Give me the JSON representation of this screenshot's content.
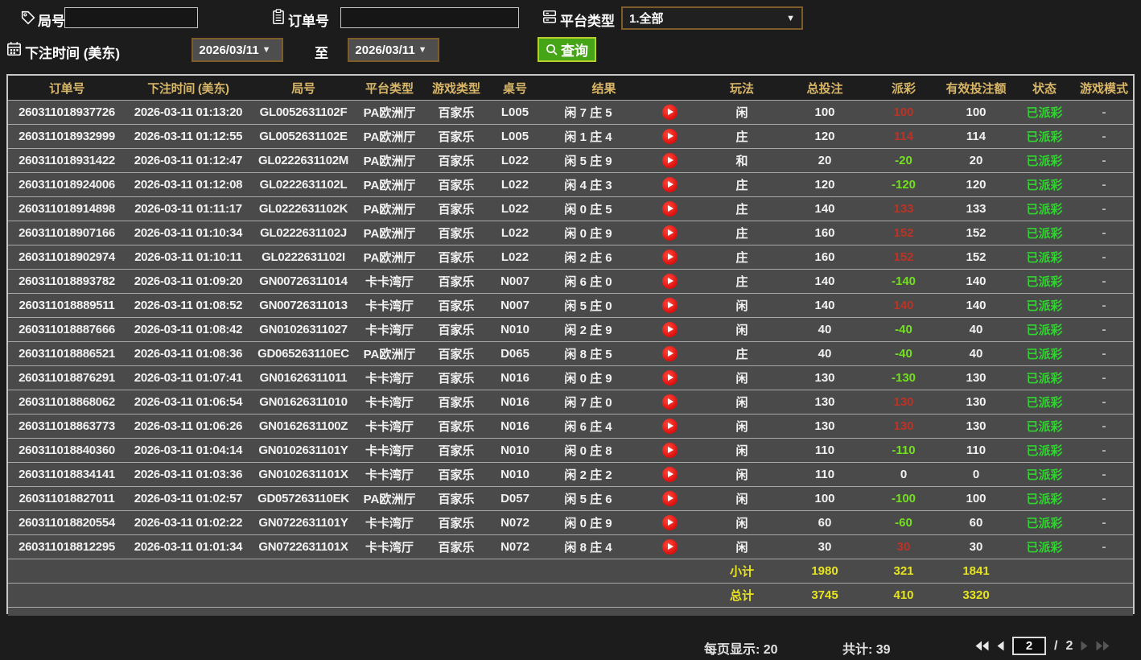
{
  "filters": {
    "round_label": "局号",
    "order_label": "订单号",
    "platform_label": "平台类型",
    "platform_value": "1.全部",
    "bet_time_label": "下注时间 (美东)",
    "date_from": "2026/03/11",
    "to_label": "至",
    "date_to": "2026/03/11",
    "search_label": "查询",
    "dropdown_caret": "▼"
  },
  "table": {
    "headers": [
      "订单号",
      "下注时间 (美东)",
      "局号",
      "平台类型",
      "游戏类型",
      "桌号",
      "结果",
      "玩法",
      "总投注",
      "派彩",
      "有效投注额",
      "状态",
      "游戏模式"
    ],
    "rows": [
      {
        "order": "260311018937726",
        "time": "2026-03-11 01:13:20",
        "round": "GL0052631102F",
        "platform": "PA欧洲厅",
        "game": "百家乐",
        "table": "L005",
        "result": "闲 7 庄 5",
        "play": "闲",
        "bet": "100",
        "payout": "100",
        "payout_color": "pos",
        "valid": "100",
        "status": "已派彩",
        "mode": "-"
      },
      {
        "order": "260311018932999",
        "time": "2026-03-11 01:12:55",
        "round": "GL0052631102E",
        "platform": "PA欧洲厅",
        "game": "百家乐",
        "table": "L005",
        "result": "闲 1 庄 4",
        "play": "庄",
        "bet": "120",
        "payout": "114",
        "payout_color": "pos",
        "valid": "114",
        "status": "已派彩",
        "mode": "-"
      },
      {
        "order": "260311018931422",
        "time": "2026-03-11 01:12:47",
        "round": "GL0222631102M",
        "platform": "PA欧洲厅",
        "game": "百家乐",
        "table": "L022",
        "result": "闲 5 庄 9",
        "play": "和",
        "bet": "20",
        "payout": "-20",
        "payout_color": "neg",
        "valid": "20",
        "status": "已派彩",
        "mode": "-"
      },
      {
        "order": "260311018924006",
        "time": "2026-03-11 01:12:08",
        "round": "GL0222631102L",
        "platform": "PA欧洲厅",
        "game": "百家乐",
        "table": "L022",
        "result": "闲 4 庄 3",
        "play": "庄",
        "bet": "120",
        "payout": "-120",
        "payout_color": "neg",
        "valid": "120",
        "status": "已派彩",
        "mode": "-"
      },
      {
        "order": "260311018914898",
        "time": "2026-03-11 01:11:17",
        "round": "GL0222631102K",
        "platform": "PA欧洲厅",
        "game": "百家乐",
        "table": "L022",
        "result": "闲 0 庄 5",
        "play": "庄",
        "bet": "140",
        "payout": "133",
        "payout_color": "pos",
        "valid": "133",
        "status": "已派彩",
        "mode": "-"
      },
      {
        "order": "260311018907166",
        "time": "2026-03-11 01:10:34",
        "round": "GL0222631102J",
        "platform": "PA欧洲厅",
        "game": "百家乐",
        "table": "L022",
        "result": "闲 0 庄 9",
        "play": "庄",
        "bet": "160",
        "payout": "152",
        "payout_color": "pos",
        "valid": "152",
        "status": "已派彩",
        "mode": "-"
      },
      {
        "order": "260311018902974",
        "time": "2026-03-11 01:10:11",
        "round": "GL0222631102I",
        "platform": "PA欧洲厅",
        "game": "百家乐",
        "table": "L022",
        "result": "闲 2 庄 6",
        "play": "庄",
        "bet": "160",
        "payout": "152",
        "payout_color": "pos",
        "valid": "152",
        "status": "已派彩",
        "mode": "-"
      },
      {
        "order": "260311018893782",
        "time": "2026-03-11 01:09:20",
        "round": "GN00726311014",
        "platform": "卡卡湾厅",
        "game": "百家乐",
        "table": "N007",
        "result": "闲 6 庄 0",
        "play": "庄",
        "bet": "140",
        "payout": "-140",
        "payout_color": "neg",
        "valid": "140",
        "status": "已派彩",
        "mode": "-"
      },
      {
        "order": "260311018889511",
        "time": "2026-03-11 01:08:52",
        "round": "GN00726311013",
        "platform": "卡卡湾厅",
        "game": "百家乐",
        "table": "N007",
        "result": "闲 5 庄 0",
        "play": "闲",
        "bet": "140",
        "payout": "140",
        "payout_color": "pos",
        "valid": "140",
        "status": "已派彩",
        "mode": "-"
      },
      {
        "order": "260311018887666",
        "time": "2026-03-11 01:08:42",
        "round": "GN01026311027",
        "platform": "卡卡湾厅",
        "game": "百家乐",
        "table": "N010",
        "result": "闲 2 庄 9",
        "play": "闲",
        "bet": "40",
        "payout": "-40",
        "payout_color": "neg",
        "valid": "40",
        "status": "已派彩",
        "mode": "-"
      },
      {
        "order": "260311018886521",
        "time": "2026-03-11 01:08:36",
        "round": "GD065263110EC",
        "platform": "PA欧洲厅",
        "game": "百家乐",
        "table": "D065",
        "result": "闲 8 庄 5",
        "play": "庄",
        "bet": "40",
        "payout": "-40",
        "payout_color": "neg",
        "valid": "40",
        "status": "已派彩",
        "mode": "-"
      },
      {
        "order": "260311018876291",
        "time": "2026-03-11 01:07:41",
        "round": "GN01626311011",
        "platform": "卡卡湾厅",
        "game": "百家乐",
        "table": "N016",
        "result": "闲 0 庄 9",
        "play": "闲",
        "bet": "130",
        "payout": "-130",
        "payout_color": "neg",
        "valid": "130",
        "status": "已派彩",
        "mode": "-"
      },
      {
        "order": "260311018868062",
        "time": "2026-03-11 01:06:54",
        "round": "GN01626311010",
        "platform": "卡卡湾厅",
        "game": "百家乐",
        "table": "N016",
        "result": "闲 7 庄 0",
        "play": "闲",
        "bet": "130",
        "payout": "130",
        "payout_color": "pos",
        "valid": "130",
        "status": "已派彩",
        "mode": "-"
      },
      {
        "order": "260311018863773",
        "time": "2026-03-11 01:06:26",
        "round": "GN0162631100Z",
        "platform": "卡卡湾厅",
        "game": "百家乐",
        "table": "N016",
        "result": "闲 6 庄 4",
        "play": "闲",
        "bet": "130",
        "payout": "130",
        "payout_color": "pos",
        "valid": "130",
        "status": "已派彩",
        "mode": "-"
      },
      {
        "order": "260311018840360",
        "time": "2026-03-11 01:04:14",
        "round": "GN0102631101Y",
        "platform": "卡卡湾厅",
        "game": "百家乐",
        "table": "N010",
        "result": "闲 0 庄 8",
        "play": "闲",
        "bet": "110",
        "payout": "-110",
        "payout_color": "neg",
        "valid": "110",
        "status": "已派彩",
        "mode": "-"
      },
      {
        "order": "260311018834141",
        "time": "2026-03-11 01:03:36",
        "round": "GN0102631101X",
        "platform": "卡卡湾厅",
        "game": "百家乐",
        "table": "N010",
        "result": "闲 2 庄 2",
        "play": "闲",
        "bet": "110",
        "payout": "0",
        "payout_color": "zero",
        "valid": "0",
        "status": "已派彩",
        "mode": "-"
      },
      {
        "order": "260311018827011",
        "time": "2026-03-11 01:02:57",
        "round": "GD057263110EK",
        "platform": "PA欧洲厅",
        "game": "百家乐",
        "table": "D057",
        "result": "闲 5 庄 6",
        "play": "闲",
        "bet": "100",
        "payout": "-100",
        "payout_color": "neg",
        "valid": "100",
        "status": "已派彩",
        "mode": "-"
      },
      {
        "order": "260311018820554",
        "time": "2026-03-11 01:02:22",
        "round": "GN0722631101Y",
        "platform": "卡卡湾厅",
        "game": "百家乐",
        "table": "N072",
        "result": "闲 0 庄 9",
        "play": "闲",
        "bet": "60",
        "payout": "-60",
        "payout_color": "neg",
        "valid": "60",
        "status": "已派彩",
        "mode": "-"
      },
      {
        "order": "260311018812295",
        "time": "2026-03-11 01:01:34",
        "round": "GN0722631101X",
        "platform": "卡卡湾厅",
        "game": "百家乐",
        "table": "N072",
        "result": "闲 8 庄 4",
        "play": "闲",
        "bet": "30",
        "payout": "30",
        "payout_color": "pos",
        "valid": "30",
        "status": "已派彩",
        "mode": "-"
      }
    ],
    "subtotal": {
      "label": "小计",
      "bet": "1980",
      "payout": "321",
      "valid": "1841"
    },
    "total": {
      "label": "总计",
      "bet": "3745",
      "payout": "410",
      "valid": "3320"
    }
  },
  "pagination": {
    "per_page_label": "每页显示: 20",
    "total_label": "共计: 39",
    "current_page": "2",
    "separator": "/",
    "total_pages": "2"
  },
  "colors": {
    "accent_gold": "#d8b667",
    "status_green": "#30d330",
    "payout_win_red": "#bb3327",
    "payout_loss_green": "#72e01e",
    "summary_yellow": "#e6e41f",
    "search_button_green": "#46a417"
  }
}
